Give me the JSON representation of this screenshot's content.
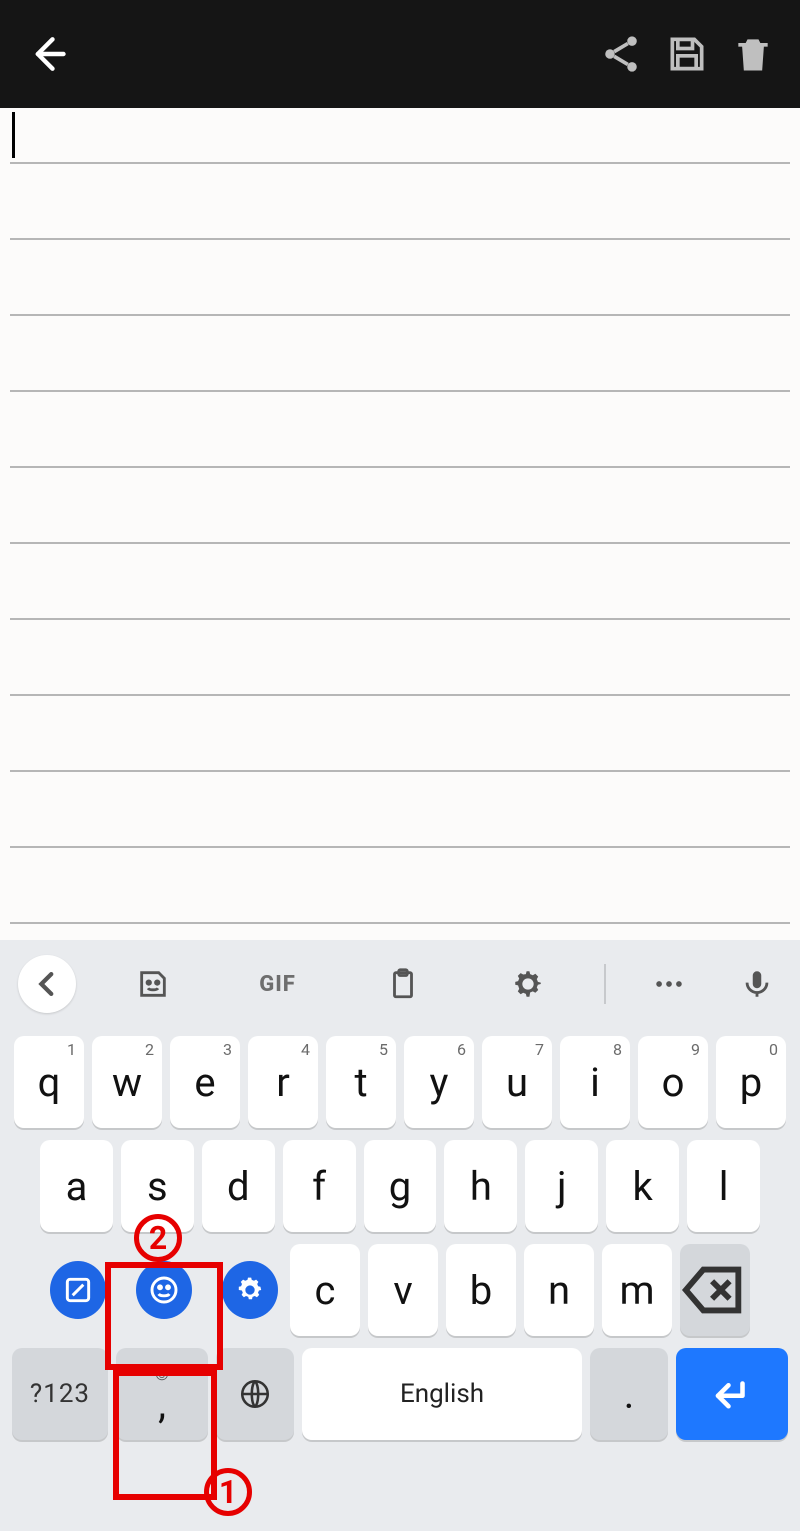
{
  "appbar": {
    "back": "Back",
    "share": "Share",
    "save": "Save",
    "delete": "Delete"
  },
  "suggestion_bar": {
    "collapse": "Collapse",
    "sticker": "Sticker",
    "gif_label": "GIF",
    "clipboard": "Clipboard",
    "settings_label": "Settings",
    "more": "More",
    "mic": "Voice input"
  },
  "keyboard": {
    "row1": [
      {
        "letter": "q",
        "sup": "1"
      },
      {
        "letter": "w",
        "sup": "2"
      },
      {
        "letter": "e",
        "sup": "3"
      },
      {
        "letter": "r",
        "sup": "4"
      },
      {
        "letter": "t",
        "sup": "5"
      },
      {
        "letter": "y",
        "sup": "6"
      },
      {
        "letter": "u",
        "sup": "7"
      },
      {
        "letter": "i",
        "sup": "8"
      },
      {
        "letter": "o",
        "sup": "9"
      },
      {
        "letter": "p",
        "sup": "0"
      }
    ],
    "row2": [
      "a",
      "s",
      "d",
      "f",
      "g",
      "h",
      "j",
      "k",
      "l"
    ],
    "row3_letters": [
      "c",
      "v",
      "b",
      "n",
      "m"
    ],
    "symbols_label": "?123",
    "comma": ",",
    "period": ".",
    "space_label": "English"
  },
  "annotations": {
    "label1": "1",
    "label2": "2"
  }
}
